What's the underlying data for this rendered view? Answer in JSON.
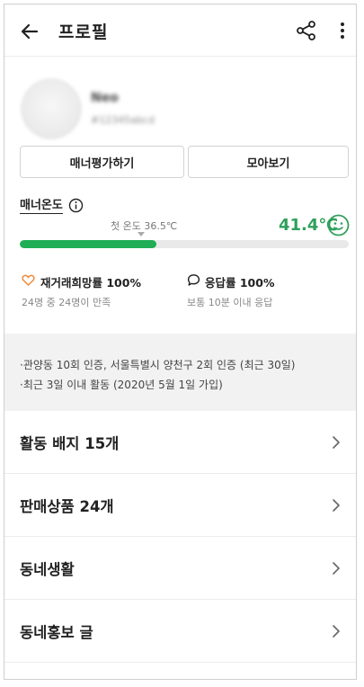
{
  "header": {
    "title": "프로필",
    "back_icon": "arrow-left-icon",
    "share_icon": "share-icon",
    "more_icon": "more-vertical-icon"
  },
  "profile": {
    "nickname": "Neo",
    "user_id": "#12345abcd"
  },
  "actions": {
    "manner_eval": "매너평가하기",
    "collect": "모아보기"
  },
  "manner": {
    "label": "매너온도",
    "first_temp": "첫 온도 36.5℃",
    "temperature": "41.4℃",
    "progress": 0.414,
    "accent": "#1fae56",
    "temp_color": "#2fa05b"
  },
  "stats": {
    "rehire": {
      "title": "재거래희망률 100%",
      "sub": "24명 중 24명이 만족",
      "icon": "heart-outline-icon"
    },
    "response": {
      "title": "응답률 100%",
      "sub": "보통 10분 이내 응답",
      "icon": "speech-bubble-icon"
    }
  },
  "verify": {
    "line1": "·관양동 10회 인증, 서울특별시 양천구 2회 인증 (최근 30일)",
    "line2": "·최근 3일 이내 활동 (2020년 5월 1일 가입)"
  },
  "menu": [
    {
      "label": "활동 배지 15개"
    },
    {
      "label": "판매상품 24개"
    },
    {
      "label": "동네생활"
    },
    {
      "label": "동네홍보 글"
    }
  ]
}
